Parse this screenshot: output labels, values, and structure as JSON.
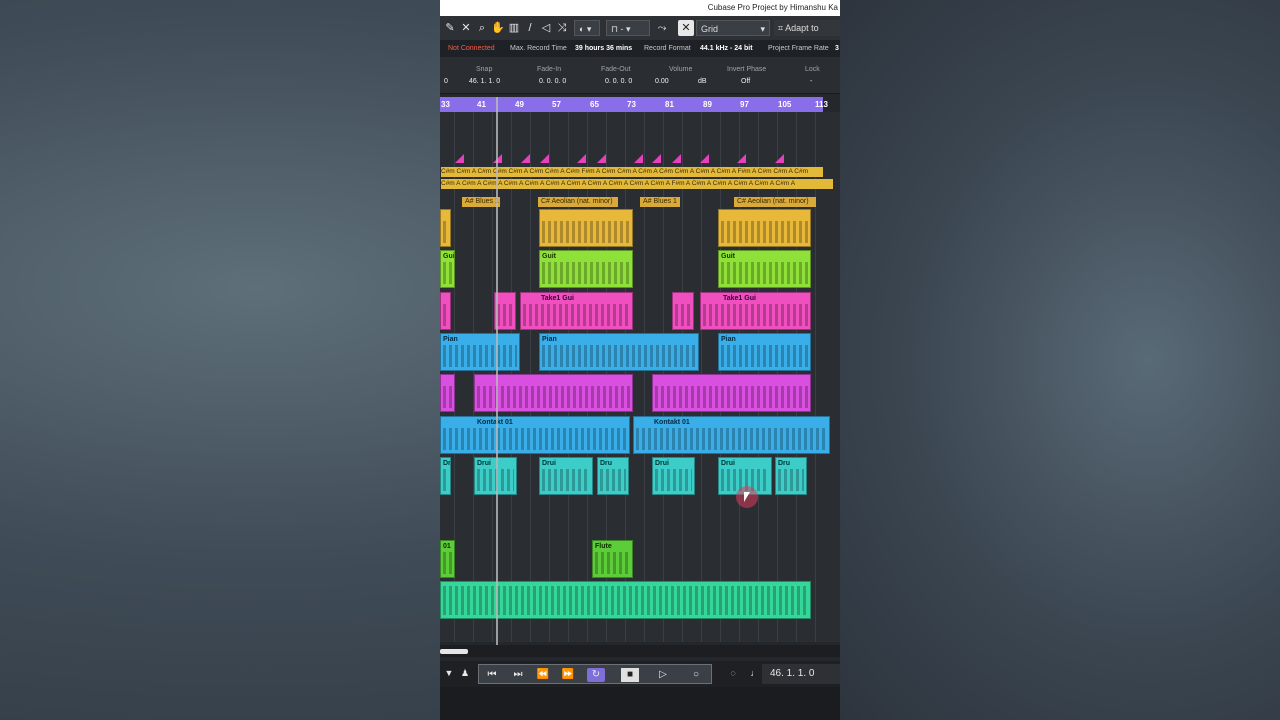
{
  "window_title": "Cubase Pro Project by Himanshu Ka",
  "toolbar": {
    "grid_label": "Grid",
    "adapt_label": "Adapt to Zoo"
  },
  "status": {
    "not_connected": "Not Connected",
    "max_record_label": "Max. Record Time",
    "max_record_value": "39 hours 36 mins",
    "record_format_label": "Record Format",
    "record_format_value": "44.1 kHz - 24 bit",
    "frame_rate_label": "Project Frame Rate",
    "frame_rate_value": "3"
  },
  "infoline": {
    "left_value": "0",
    "snap_label": "Snap",
    "snap_value": "46. 1. 1.   0",
    "fadein_label": "Fade-In",
    "fadein_value": "0. 0. 0.   0",
    "fadeout_label": "Fade-Out",
    "fadeout_value": "0. 0. 0.   0",
    "volume_label": "Volume",
    "volume_value": "0.00",
    "volume_unit": "dB",
    "invert_label": "Invert Phase",
    "invert_value": "Off",
    "lock_label": "Lock",
    "lock_value": "-"
  },
  "ruler": [
    "33",
    "41",
    "49",
    "57",
    "65",
    "73",
    "81",
    "89",
    "97",
    "105",
    "113"
  ],
  "chord_track": {
    "row1": "C#m C#m A C#m C#m C#m A C#m C#m A C#m F#m A C#m C#m A C#m A C#m C#m A C#m A C#m A F#m A C#m C#m A C#m",
    "row2": "C#m A C#m A C#m A C#m A C#m A C#m A C#m A C#m A C#m A C#m A C#m A F#m A C#m A C#m A C#m A C#m A C#m A"
  },
  "scales": [
    "A# Blues 1",
    "C# Aeolian (nat. minor)",
    "A# Blues 1",
    "C# Aeolian (nat. minor)"
  ],
  "clip_labels": {
    "guitar": "Guit",
    "take": "Take1 Gui",
    "piano": "Pian",
    "kontakt": "Kontakt 01",
    "drums": "Drui",
    "drums_short": "Dru",
    "flute": "Flute",
    "num": "01"
  },
  "transport": {
    "position": "46.  1.  1.   0"
  },
  "colors": {
    "ruler": "#8a6de8",
    "yellow": "#e8b83a",
    "lime": "#8fe038",
    "pink": "#ef4fbf",
    "blue": "#3aaee8",
    "magenta": "#d94fe0",
    "teal": "#3ccdc9",
    "green": "#5ccc38",
    "mint": "#35d69a"
  }
}
